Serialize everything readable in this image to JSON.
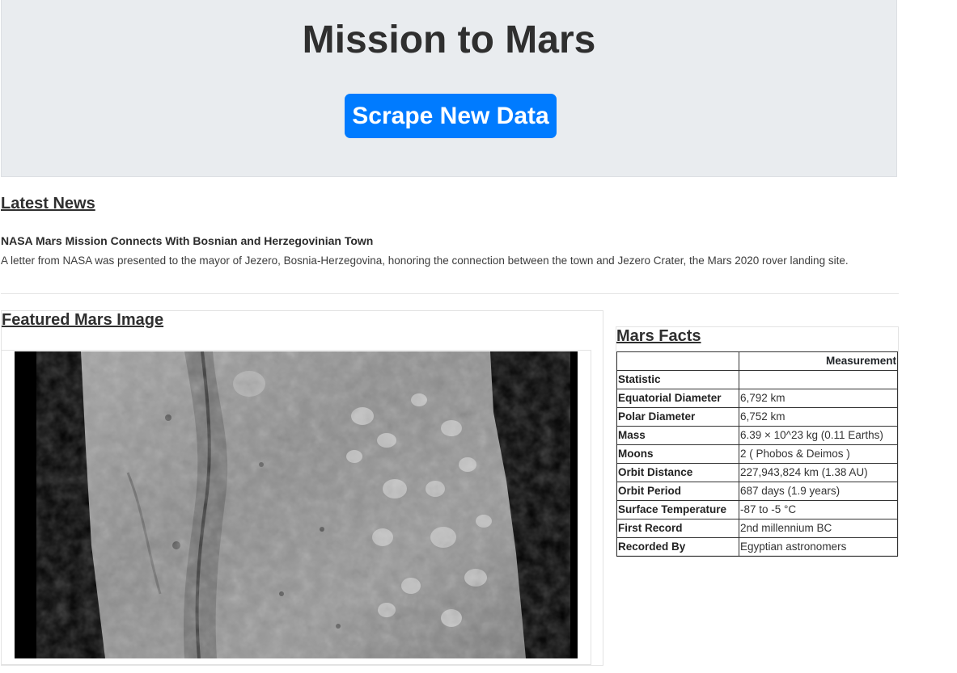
{
  "header": {
    "title": "Mission to Mars",
    "scrape_button": "Scrape New Data"
  },
  "news": {
    "heading": "Latest News",
    "title": "NASA Mars Mission Connects With Bosnian and Herzegovinian Town",
    "body": "A letter from NASA was presented to the mayor of Jezero, Bosnia-Herzegovina, honoring the connection between the town and Jezero Crater, the Mars 2020 rover landing site."
  },
  "featured": {
    "heading": "Featured Mars Image"
  },
  "facts": {
    "heading": "Mars Facts",
    "column_header": "Measurement",
    "rows": [
      {
        "stat": "Statistic",
        "value": ""
      },
      {
        "stat": "Equatorial Diameter",
        "value": "6,792 km"
      },
      {
        "stat": "Polar Diameter",
        "value": "6,752 km"
      },
      {
        "stat": "Mass",
        "value": "6.39 × 10^23 kg (0.11 Earths)"
      },
      {
        "stat": "Moons",
        "value": "2 ( Phobos & Deimos )"
      },
      {
        "stat": "Orbit Distance",
        "value": "227,943,824 km (1.38 AU)"
      },
      {
        "stat": "Orbit Period",
        "value": "687 days (1.9 years)"
      },
      {
        "stat": "Surface Temperature",
        "value": "-87 to -5 °C"
      },
      {
        "stat": "First Record",
        "value": "2nd millennium BC"
      },
      {
        "stat": "Recorded By",
        "value": "Egyptian astronomers"
      }
    ]
  }
}
